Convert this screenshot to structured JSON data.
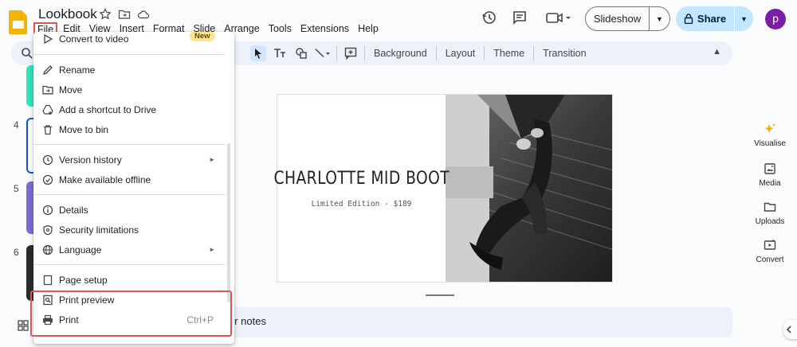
{
  "header": {
    "doc_title": "Lookbook",
    "menus": [
      "File",
      "Edit",
      "View",
      "Insert",
      "Format",
      "Slide",
      "Arrange",
      "Tools",
      "Extensions",
      "Help"
    ],
    "slideshow_label": "Slideshow",
    "share_label": "Share",
    "avatar_letter": "p"
  },
  "toolbar": {
    "background": "Background",
    "layout": "Layout",
    "theme": "Theme",
    "transition": "Transition"
  },
  "filmstrip": {
    "slide_numbers": [
      "4",
      "5",
      "6"
    ]
  },
  "slide": {
    "heading": "CHARLOTTE MID BOOT",
    "subheading": "Limited Edition - $189"
  },
  "notes": {
    "placeholder_tail": "er notes"
  },
  "side_panel": {
    "items": [
      "Visualise",
      "Media",
      "Uploads",
      "Convert"
    ]
  },
  "file_menu": {
    "items": [
      {
        "label": "Convert to video",
        "badge": "New"
      },
      {
        "label": "Rename"
      },
      {
        "label": "Move"
      },
      {
        "label": "Add a shortcut to Drive"
      },
      {
        "label": "Move to bin"
      },
      {
        "label": "Version history"
      },
      {
        "label": "Make available offline"
      },
      {
        "label": "Details"
      },
      {
        "label": "Security limitations"
      },
      {
        "label": "Language"
      },
      {
        "label": "Page setup"
      },
      {
        "label": "Print preview"
      },
      {
        "label": "Print",
        "shortcut": "Ctrl+P"
      }
    ]
  },
  "colors": {
    "highlight": "#e25555",
    "share_bg": "#c2e7ff",
    "avatar_bg": "#7b1fa2",
    "new_badge": "#fde293"
  }
}
